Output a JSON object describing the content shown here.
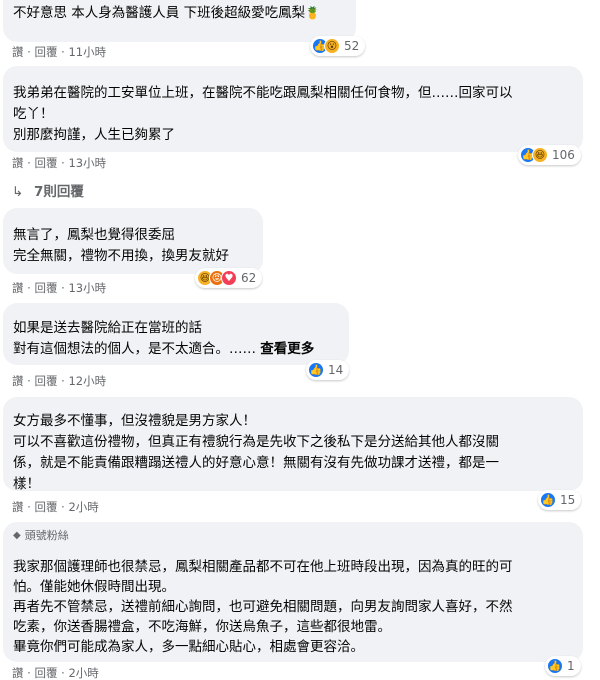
{
  "comments": [
    {
      "author": "",
      "lines": [
        "不好意思 本人身為醫護人員 下班後超級愛吃鳳梨"
      ],
      "emoji": "🍍",
      "like": "讚",
      "reply": "回覆",
      "time": "11小時",
      "reactions": [
        "like",
        "wow"
      ],
      "count": "52"
    },
    {
      "author": "",
      "lines": [
        "我弟弟在醫院的工安單位上班，在醫院不能吃跟鳳梨相關任何食物，但……回家可以",
        "吃丫！",
        "別那麼拘謹，人生已夠累了"
      ],
      "like": "讚",
      "reply": "回覆",
      "time": "13小時",
      "reactions": [
        "like",
        "haha"
      ],
      "count": "106",
      "replies_label": "7則回覆"
    },
    {
      "author": "",
      "lines": [
        "無言了，鳳梨也覺得很委屈",
        "完全無關，禮物不用換，換男友就好"
      ],
      "like": "讚",
      "reply": "回覆",
      "time": "13小時",
      "reactions": [
        "haha",
        "angry",
        "love"
      ],
      "count": "62"
    },
    {
      "author": "",
      "lines": [
        "如果是送去醫院給正在當班的話",
        "對有這個想法的個人，是不太適合。……"
      ],
      "more": "查看更多",
      "like": "讚",
      "reply": "回覆",
      "time": "12小時",
      "reactions": [
        "like"
      ],
      "count": "14"
    },
    {
      "author": "",
      "lines": [
        "女方最多不懂事，但沒禮貌是男方家人！",
        "可以不喜歡這份禮物，但真正有禮貌行為是先收下之後私下是分送給其他人都沒關",
        "係，就是不能責備跟糟蹋送禮人的好意心意！無關有沒有先做功課才送禮，都是一",
        "樣！"
      ],
      "like": "讚",
      "reply": "回覆",
      "time": "2小時",
      "reactions": [
        "like"
      ],
      "count": "15"
    },
    {
      "badge": "頭號粉絲",
      "author": "",
      "lines": [
        "我家那個護理師也很禁忌，鳳梨相關產品都不可在他上班時段出現，因為真的旺的可",
        "怕。僅能她休假時間出現。",
        "再者先不管禁忌，送禮前細心詢問，也可避免相關問題，向男友詢問家人喜好，不然",
        "吃素，你送香腸禮盒，不吃海鮮，你送烏魚子，這些都很地雷。",
        "畢竟你們可能成為家人，多一點細心貼心，相處會更容洽。"
      ],
      "like": "讚",
      "reply": "回覆",
      "time": "2小時",
      "reactions": [
        "like"
      ],
      "count": "1"
    }
  ]
}
